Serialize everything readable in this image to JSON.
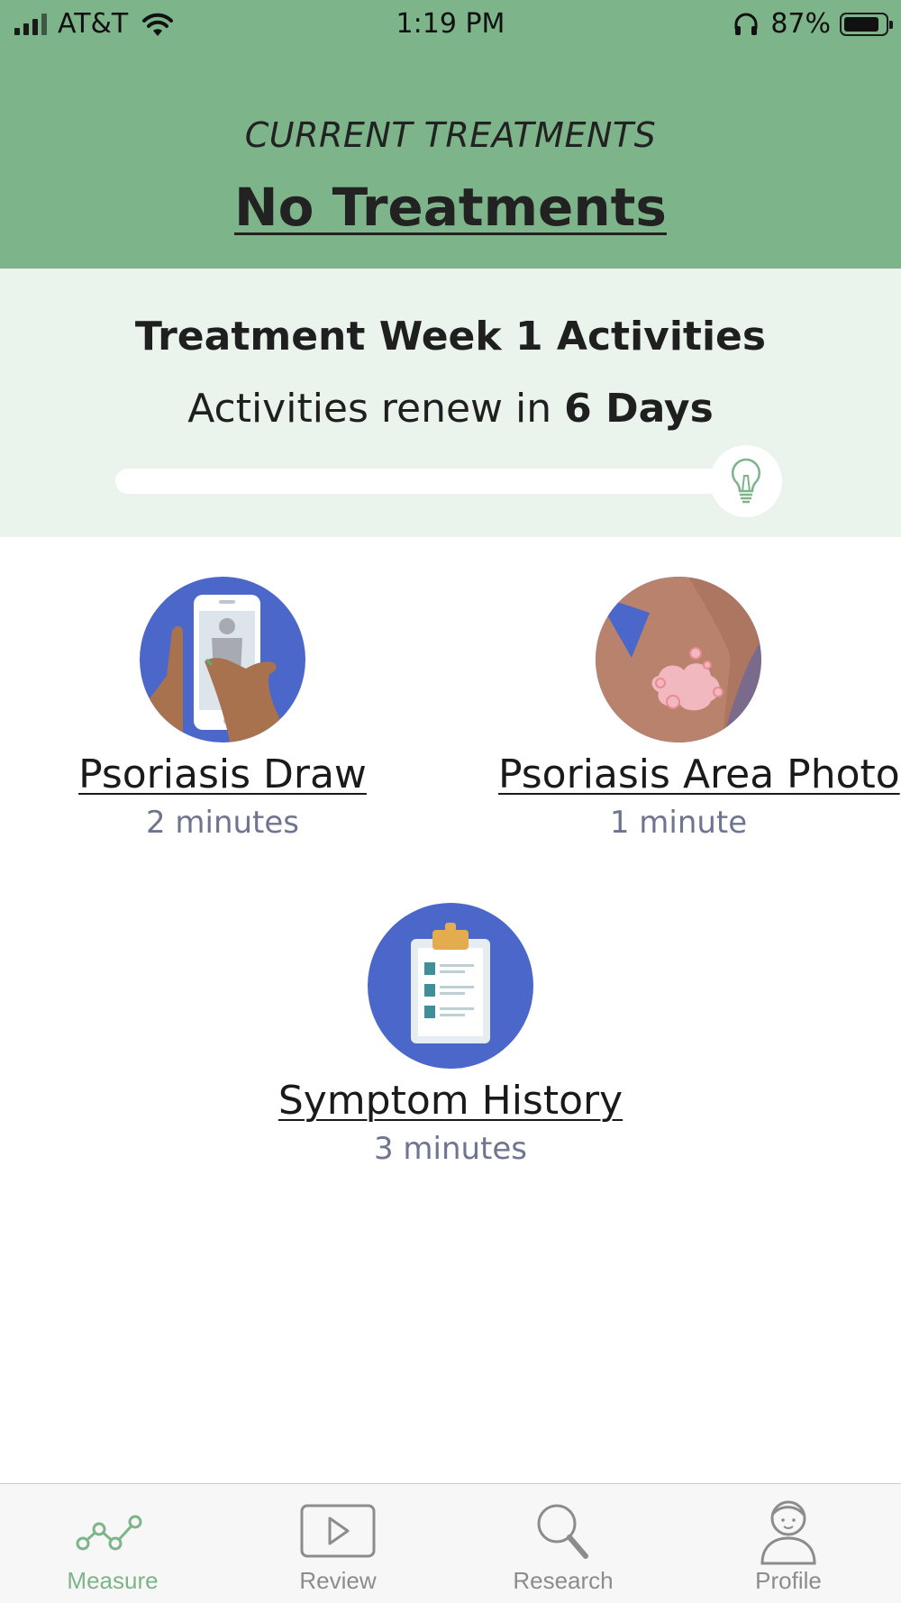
{
  "status_bar": {
    "carrier": "AT&T",
    "time": "1:19 PM",
    "battery_percent": "87%",
    "battery_level": 0.87
  },
  "current_treatments": {
    "label": "CURRENT TREATMENTS",
    "value": "No Treatments"
  },
  "week": {
    "title": "Treatment Week 1 Activities",
    "renew_prefix": "Activities renew in",
    "renew_value": "6 Days",
    "progress": 1.0,
    "tip_icon": "lightbulb-icon"
  },
  "activities": [
    {
      "name": "Psoriasis Draw",
      "duration": "2 minutes",
      "icon": "phone-body-draw-icon"
    },
    {
      "name": "Psoriasis Area Photo",
      "duration": "1 minute",
      "icon": "skin-patch-icon"
    },
    {
      "name": "Symptom History",
      "duration": "3 minutes",
      "icon": "clipboard-icon"
    }
  ],
  "tabs": [
    {
      "label": "Measure",
      "icon": "line-chart-icon",
      "active": true
    },
    {
      "label": "Review",
      "icon": "play-icon",
      "active": false
    },
    {
      "label": "Research",
      "icon": "magnifier-icon",
      "active": false
    },
    {
      "label": "Profile",
      "icon": "person-icon",
      "active": false
    }
  ],
  "colors": {
    "header_green": "#7db48a",
    "panel_mint": "#eaf3ec",
    "activity_blue": "#4a67c9",
    "active_tab": "#7db48a",
    "inactive_tab": "#8c8c8c"
  }
}
